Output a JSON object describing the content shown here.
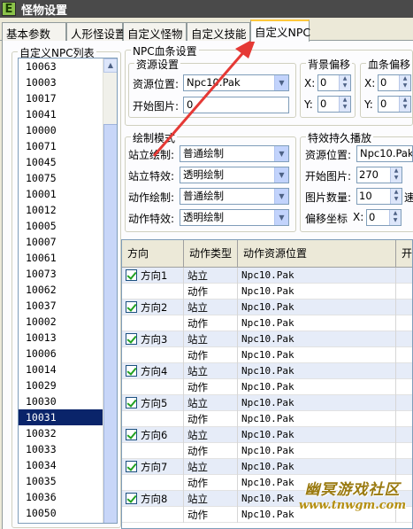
{
  "window": {
    "title": "怪物设置",
    "icon_letter": "E"
  },
  "tabs": [
    {
      "label": "基本参数"
    },
    {
      "label": "人形怪设置"
    },
    {
      "label": "自定义怪物"
    },
    {
      "label": "自定义技能"
    },
    {
      "label": "自定义NPC"
    }
  ],
  "npc_list": {
    "legend": "自定义NPC列表",
    "selected": "10031",
    "items": [
      "10063",
      "10003",
      "10017",
      "10041",
      "10000",
      "10071",
      "10045",
      "10075",
      "10001",
      "10012",
      "10005",
      "10007",
      "10061",
      "10073",
      "10062",
      "10037",
      "10002",
      "10013",
      "10006",
      "10014",
      "10029",
      "10030",
      "10031",
      "10032",
      "10033",
      "10034",
      "10035",
      "10036",
      "10050"
    ]
  },
  "hp_bar": {
    "legend": "NPC血条设置",
    "resource_group": "资源设置",
    "resource_pos_label": "资源位置:",
    "resource_pos_value": "Npc10.Pak",
    "start_image_label": "开始图片:",
    "start_image_value": "0",
    "bg_offset": {
      "legend": "背景偏移",
      "x_label": "X:",
      "x_value": "0",
      "y_label": "Y:",
      "y_value": "0"
    },
    "bar_offset": {
      "legend": "血条偏移",
      "x_label": "X:",
      "x_value": "0",
      "y_label": "Y:",
      "y_value": "0"
    }
  },
  "draw_mode": {
    "legend": "绘制模式",
    "rows": [
      {
        "label": "站立绘制:",
        "value": "普通绘制"
      },
      {
        "label": "站立特效:",
        "value": "透明绘制"
      },
      {
        "label": "动作绘制:",
        "value": "普通绘制"
      },
      {
        "label": "动作特效:",
        "value": "透明绘制"
      }
    ]
  },
  "effect": {
    "legend": "特效持久播放",
    "resource_pos_label": "资源位置:",
    "resource_pos_value": "Npc10.Pak",
    "start_image_label": "开始图片:",
    "start_image_value": "270",
    "image_count_label": "图片数量:",
    "image_count_value": "10",
    "image_count_suffix": "速",
    "offset_label": "偏移坐标",
    "offset_x_label": "X:",
    "offset_x_value": "0"
  },
  "grid": {
    "headers": [
      "方向",
      "动作类型",
      "动作资源位置",
      "开始"
    ],
    "rows": [
      {
        "direction": "方向1",
        "type": "站立",
        "resource": "Npc10.Pak"
      },
      {
        "direction": "",
        "type": "动作",
        "resource": "Npc10.Pak"
      },
      {
        "direction": "方向2",
        "type": "站立",
        "resource": "Npc10.Pak"
      },
      {
        "direction": "",
        "type": "动作",
        "resource": "Npc10.Pak"
      },
      {
        "direction": "方向3",
        "type": "站立",
        "resource": "Npc10.Pak"
      },
      {
        "direction": "",
        "type": "动作",
        "resource": "Npc10.Pak"
      },
      {
        "direction": "方向4",
        "type": "站立",
        "resource": "Npc10.Pak"
      },
      {
        "direction": "",
        "type": "动作",
        "resource": "Npc10.Pak"
      },
      {
        "direction": "方向5",
        "type": "站立",
        "resource": "Npc10.Pak"
      },
      {
        "direction": "",
        "type": "动作",
        "resource": "Npc10.Pak"
      },
      {
        "direction": "方向6",
        "type": "站立",
        "resource": "Npc10.Pak"
      },
      {
        "direction": "",
        "type": "动作",
        "resource": "Npc10.Pak"
      },
      {
        "direction": "方向7",
        "type": "站立",
        "resource": "Npc10.Pak"
      },
      {
        "direction": "",
        "type": "动作",
        "resource": "Npc10.Pak"
      },
      {
        "direction": "方向8",
        "type": "站立",
        "resource": "Npc10.Pak"
      },
      {
        "direction": "",
        "type": "动作",
        "resource": "Npc10.Pak"
      }
    ]
  },
  "watermark": {
    "line1": "幽冥游戏社区",
    "line2": "www.tnwgm.com"
  },
  "colors": {
    "annotation_arrow": "#e53935",
    "selection": "#0a246a",
    "tab_accent": "#ffc83c"
  }
}
